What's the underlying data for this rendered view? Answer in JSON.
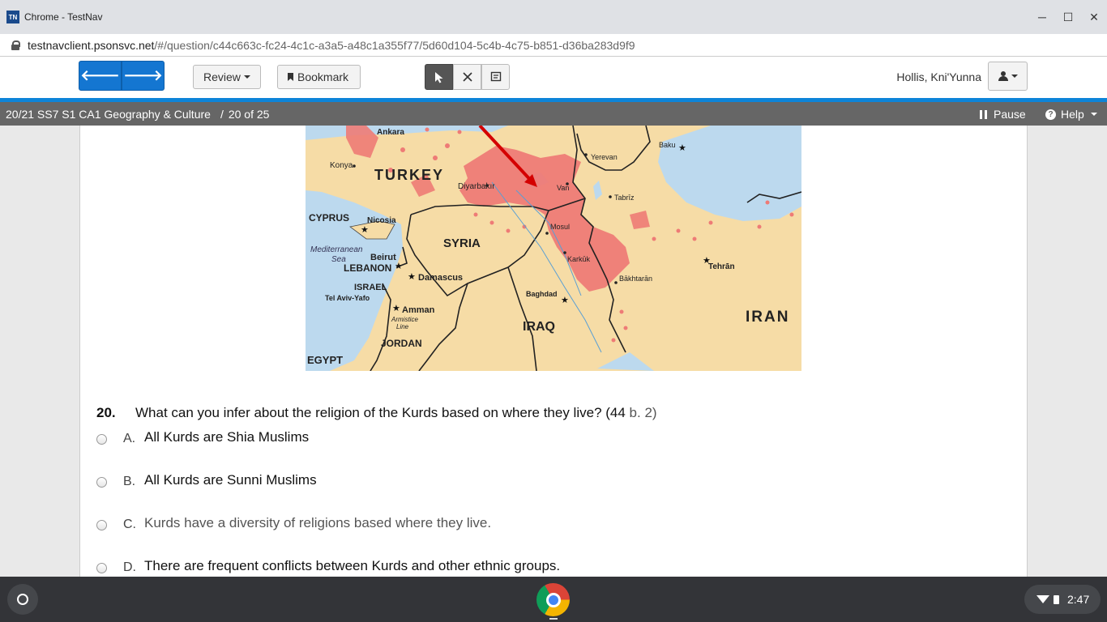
{
  "window": {
    "logo": "TN",
    "title": "Chrome - TestNav",
    "minimize": "─",
    "maximize": "☐",
    "close": "✕"
  },
  "address": {
    "host": "testnavclient.psonsvc.net",
    "path": "/#/question/c44c663c-fc24-4c1c-a3a5-a48c1a355f77/5d60d104-5c4b-4c75-b851-d36ba283d9f9"
  },
  "toolbar": {
    "prev_icon": "🡐",
    "next_icon": "🡒",
    "review_label": "Review",
    "bookmark_label": "Bookmark",
    "user_name": "Hollis, Kni'Yunna"
  },
  "testbar": {
    "test_name": "20/21 SS7 S1 CA1 Geography & Culture",
    "separator": "/",
    "position": "20 of 25",
    "pause_label": "Pause",
    "help_label": "Help"
  },
  "map_labels": {
    "ankara": "Ankara",
    "turkey": "TURKEY",
    "konya": "Konya",
    "yerevan": "Yerevan",
    "baku": "Baku",
    "diyarbakir": "Diyarbakır",
    "van": "Van",
    "tabriz": "Tabrīz",
    "cyprus": "CYPRUS",
    "nicosia": "Nicosia",
    "mosul": "Mosul",
    "mediterranean": "Mediterranean",
    "sea": "Sea",
    "syria": "SYRIA",
    "beirut": "Beirut",
    "lebanon": "LEBANON",
    "karkuk": "Karkūk",
    "tehran": "Tehrān",
    "damascus": "Damascus",
    "israel": "ISRAEL",
    "bakhtaran": "Bākhtarān",
    "telaviv": "Tel Aviv-Yafo",
    "baghdad": "Baghdad",
    "amman": "Amman",
    "armistice": "Armistice",
    "line": "Line",
    "iraq": "IRAQ",
    "iran": "IRAN",
    "jordan": "JORDAN",
    "egypt": "EGYPT"
  },
  "question": {
    "number": "20.",
    "text": "What can you infer about the religion of the Kurds based on where they live? (44",
    "text_muted": "b. 2)",
    "options": [
      {
        "letter": "A.",
        "text": "All Kurds are Shia Muslims"
      },
      {
        "letter": "B.",
        "text": "All Kurds are Sunni Muslims"
      },
      {
        "letter": "C.",
        "text": "Kurds have a diversity of religions based where they live."
      },
      {
        "letter": "D.",
        "text": "There are frequent conflicts between Kurds and other ethnic groups."
      }
    ]
  },
  "taskbar": {
    "time": "2:47"
  },
  "colors": {
    "nav_blue": "#1476d1",
    "accent_blue": "#0d84d8",
    "testbar_gray": "#666666",
    "kurd_region": "#ee7b76",
    "land": "#f6dca6",
    "water": "#bcd9ee"
  }
}
